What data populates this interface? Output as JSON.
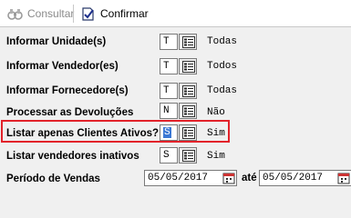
{
  "toolbar": {
    "consultar_label": "Consultar",
    "confirmar_label": "Confirmar"
  },
  "rows": [
    {
      "label": "Informar Unidade(s)",
      "value": "T",
      "desc": "Todas"
    },
    {
      "label": "Informar Vendedor(es)",
      "value": "T",
      "desc": "Todos"
    },
    {
      "label": "Informar Fornecedore(s)",
      "value": "T",
      "desc": "Todas"
    },
    {
      "label": "Processar as Devoluções",
      "value": "N",
      "desc": "Não"
    },
    {
      "label": "Listar apenas Clientes Ativos?",
      "value": "S",
      "desc": "Sim"
    },
    {
      "label": "Listar vendedores inativos",
      "value": "S",
      "desc": "Sim"
    }
  ],
  "periodo": {
    "label": "Período de Vendas",
    "start": "05/05/2017",
    "separator": "até",
    "end": "05/05/2017"
  },
  "colors": {
    "highlight": "#e2222a",
    "selection": "#3b78d4"
  }
}
